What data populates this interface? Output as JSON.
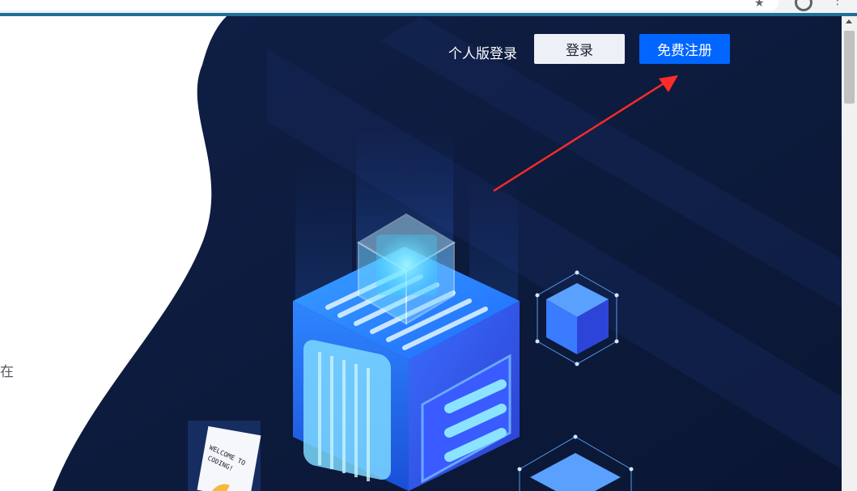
{
  "browser": {
    "star_icon": "star-icon",
    "extension_icon": "circle-icon",
    "menu_icon": "kebab-menu-icon"
  },
  "page": {
    "left_text": "在"
  },
  "nav": {
    "personal_login_label": "个人版登录",
    "login_button": "登录",
    "signup_button": "免费注册"
  },
  "illustration": {
    "screen_text_line1": "WELCOME TO",
    "screen_text_line2": "CODING!"
  },
  "colors": {
    "hero_bg": "#0e1b3d",
    "primary_blue": "#0066ff",
    "login_bg": "#edf0f7",
    "annotation": "#ff2a2a"
  }
}
